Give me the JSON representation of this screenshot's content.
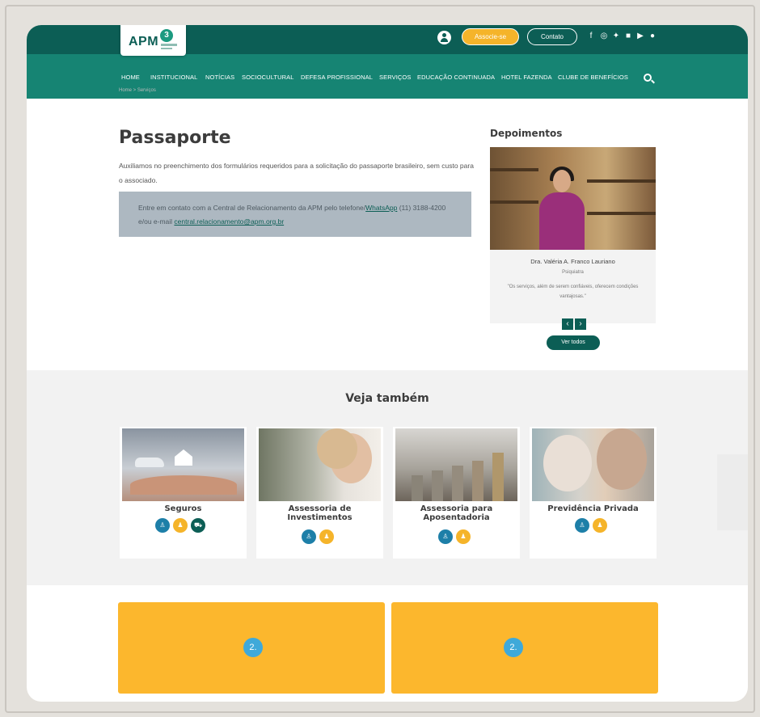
{
  "header": {
    "logo": "APM",
    "logo_mark": "3",
    "associe_label": "Associe-se",
    "contato_label": "Contato",
    "social": [
      {
        "name": "facebook",
        "glyph": "f"
      },
      {
        "name": "instagram",
        "glyph": "◎"
      },
      {
        "name": "twitter",
        "glyph": "✦"
      },
      {
        "name": "linkedin",
        "glyph": "■"
      },
      {
        "name": "youtube",
        "glyph": "▶"
      },
      {
        "name": "spotify",
        "glyph": "●"
      }
    ]
  },
  "nav": {
    "items": [
      "HOME",
      "INSTITUCIONAL",
      "NOTÍCIAS",
      "SOCIOCULTURAL",
      "DEFESA PROFISSIONAL",
      "SERVIÇOS",
      "EDUCAÇÃO CONTINUADA",
      "HOTEL FAZENDA",
      "CLUBE DE BENEFÍCIOS"
    ]
  },
  "breadcrumb": "Home > Serviços",
  "main": {
    "title": "Passaporte",
    "intro": "Auxiliamos no preenchimento dos formulários requeridos para a solicitação do passaporte brasileiro, sem custo para o associado.",
    "contact_prefix": "Entre em contato com a Central de Relacionamento da APM pelo telefone/",
    "contact_link1": "WhatsApp",
    "contact_middle": " (11) 3188-4200 e/ou e-mail ",
    "contact_link2": "central.relacionamento@apm.org.br"
  },
  "testimonials": {
    "title": "Depoimentos",
    "name": "Dra. Valéria A. Franco Lauriano",
    "role": "Psiquiatra",
    "quote": "\"Os serviços, além de serem confiáveis, oferecem condições vantajosas.\"",
    "prev": "‹",
    "next": "›",
    "ver_todos": "Ver todos"
  },
  "see_also": {
    "title": "Veja também",
    "cards": [
      {
        "title": "Seguros"
      },
      {
        "title": "Assessoria de Investimentos"
      },
      {
        "title": "Assessoria para Aposentadoria"
      },
      {
        "title": "Previdência Privada"
      }
    ]
  },
  "promos": [
    {
      "badge": "2."
    },
    {
      "badge": "2."
    }
  ],
  "colors": {
    "primary": "#0c5e55",
    "nav": "#168473",
    "accent": "#f5b42a",
    "promo": "#fcb72d"
  }
}
